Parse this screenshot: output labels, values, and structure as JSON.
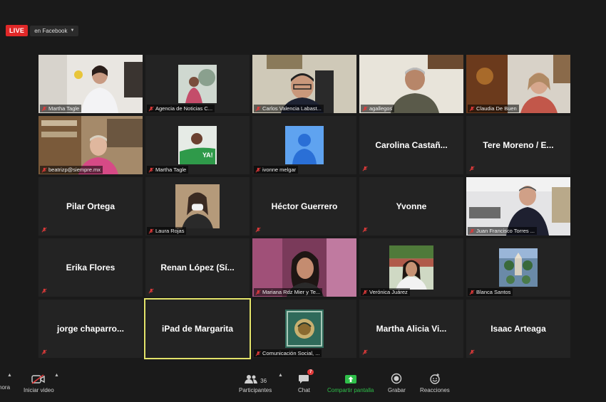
{
  "live": {
    "badge": "LIVE",
    "destination": "en Facebook"
  },
  "tiles": [
    {
      "name": "Martha Tagle",
      "type": "video"
    },
    {
      "name": "Agencia de Noticias C...",
      "type": "image"
    },
    {
      "name": "Carlos Valencia Labast...",
      "type": "video"
    },
    {
      "name": "agallegos",
      "type": "video"
    },
    {
      "name": "Claudia De Buen",
      "type": "video"
    },
    {
      "name": "beatrizp@siempre.mx",
      "type": "video"
    },
    {
      "name": "Martha Tagle",
      "type": "image"
    },
    {
      "name": "ivonne melgar",
      "type": "avatar"
    },
    {
      "name": "Carolina  Castañ...",
      "type": "name"
    },
    {
      "name": "Tere Moreno / E...",
      "type": "name"
    },
    {
      "name": "Pilar Ortega",
      "type": "name"
    },
    {
      "name": "Laura Rojas",
      "type": "image"
    },
    {
      "name": "Héctor Guerrero",
      "type": "name"
    },
    {
      "name": "Yvonne",
      "type": "name"
    },
    {
      "name": "Juan Francisco Torres ...",
      "type": "video"
    },
    {
      "name": "Erika Flores",
      "type": "name"
    },
    {
      "name": "Renan  López  (Sí...",
      "type": "name"
    },
    {
      "name": "Mariana Rdz Mier y Te...",
      "type": "video"
    },
    {
      "name": "Verónica Juárez",
      "type": "image"
    },
    {
      "name": "Blanca Santos",
      "type": "image"
    },
    {
      "name": "jorge  chaparro...",
      "type": "name"
    },
    {
      "name": "iPad de Margarita",
      "type": "name"
    },
    {
      "name": "Comunicación Social, ...",
      "type": "image"
    },
    {
      "name": "Martha  Alicia  Vi...",
      "type": "name"
    },
    {
      "name": "Isaac Arteaga",
      "type": "name"
    }
  ],
  "toolbar": {
    "mute_partial": "hora",
    "video": "Iniciar video",
    "participants": "Participantes",
    "participants_count": "36",
    "chat": "Chat",
    "chat_badge": "7",
    "share": "Compartir pantalla",
    "record": "Grabar",
    "reactions": "Reacciones"
  },
  "colors": {
    "active_border": "#e3e36a",
    "share_green": "#2fbf4a",
    "live_red": "#e02828"
  }
}
